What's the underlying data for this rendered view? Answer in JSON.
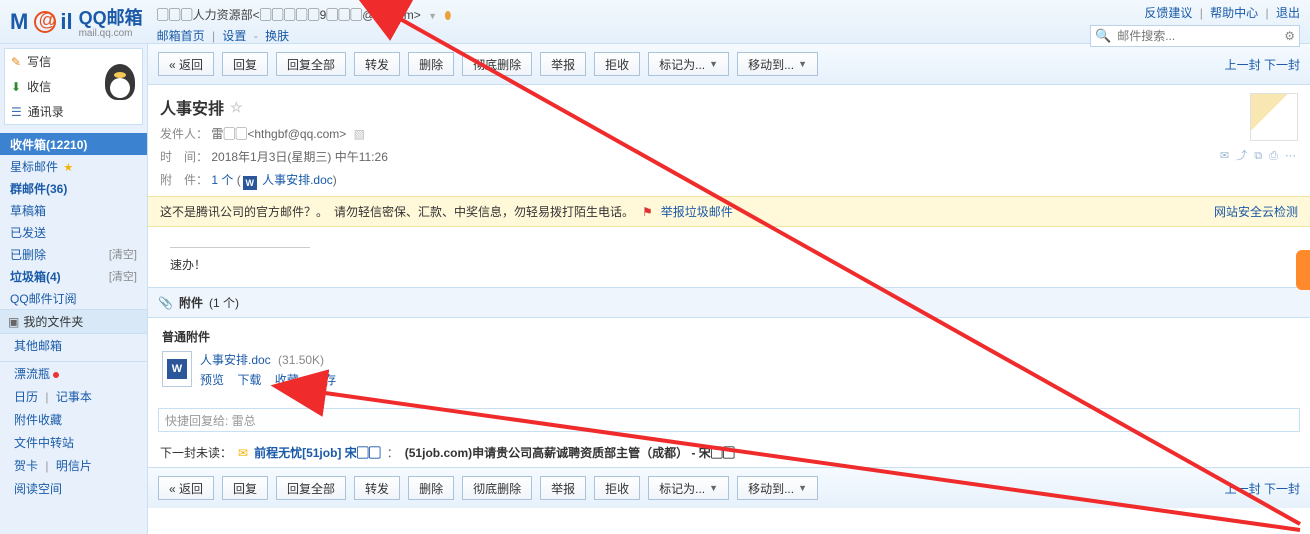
{
  "header": {
    "brand_main": "QQ邮箱",
    "brand_sub": "mail.qq.com",
    "account_display": "▢▢▢人力资源部<▢▢▢▢▢9▢▢▢@qq.com>",
    "nav": {
      "home": "邮箱首页",
      "settings": "设置",
      "skin": "换肤"
    },
    "links": {
      "feedback": "反馈建议",
      "help": "帮助中心",
      "logout": "退出"
    },
    "search_placeholder": "邮件搜索..."
  },
  "sidebar": {
    "primary": {
      "compose": "写信",
      "receive": "收信",
      "contacts": "通讯录"
    },
    "folders": [
      {
        "label": "收件箱(12210)",
        "selected": true
      },
      {
        "label": "星标邮件 ",
        "star": true
      },
      {
        "label": "群邮件(36)"
      },
      {
        "label": "草稿箱"
      },
      {
        "label": "已发送"
      },
      {
        "label": "已删除",
        "extra": "[清空]"
      },
      {
        "label": "垃圾箱(4)",
        "extra": "[清空]"
      },
      {
        "label": "QQ邮件订阅"
      }
    ],
    "myfiles_head": "我的文件夹",
    "myfiles_items": [
      "其他邮箱"
    ],
    "extras": {
      "drift": "漂流瓶",
      "calendar": "日历",
      "notes": "记事本",
      "attach_collect": "附件收藏",
      "transfer": "文件中转站",
      "cards": "贺卡",
      "mingxin": "明信片",
      "read_space": "阅读空间"
    }
  },
  "toolbar": {
    "back": "« 返回",
    "reply": "回复",
    "reply_all": "回复全部",
    "forward": "转发",
    "delete": "删除",
    "delete_full": "彻底删除",
    "report": "举报",
    "reject": "拒收",
    "mark_as": "标记为...",
    "move_to": "移动到...",
    "prev": "上一封",
    "next": "下一封"
  },
  "mail": {
    "subject": "人事安排",
    "from_label": "发件人：",
    "from_value": "雷▢▢<hthgbf@qq.com>",
    "time_label": "时　间：",
    "time_value": "2018年1月3日(星期三) 中午11:26",
    "attach_label": "附　件：",
    "attach_count": "1 个",
    "attach_name": "人事安排.doc",
    "warn_text": "这不是腾讯公司的官方邮件？。　请勿轻信密保、汇款、中奖信息，勿轻易拨打陌生电话。",
    "warn_report": "举报垃圾邮件",
    "warn_right": "网站安全云检测",
    "body": "速办！"
  },
  "attachments": {
    "section_title": "附件",
    "section_count": "(1 个)",
    "boxed_title": "普通附件",
    "file_name": "人事安排.doc",
    "file_size": "(31.50K)",
    "actions": {
      "preview": "预览",
      "download": "下载",
      "collect": "收藏",
      "save": "转存"
    }
  },
  "quick_reply_placeholder": "快捷回复给: 雷总",
  "next_unread": {
    "prefix": "下一封未读：",
    "sender": "前程无忧[51job] 宋▢▢",
    "subject": "(51job.com)申请贵公司高薪诚聘资质部主管（成都） - 宋▢▢"
  }
}
